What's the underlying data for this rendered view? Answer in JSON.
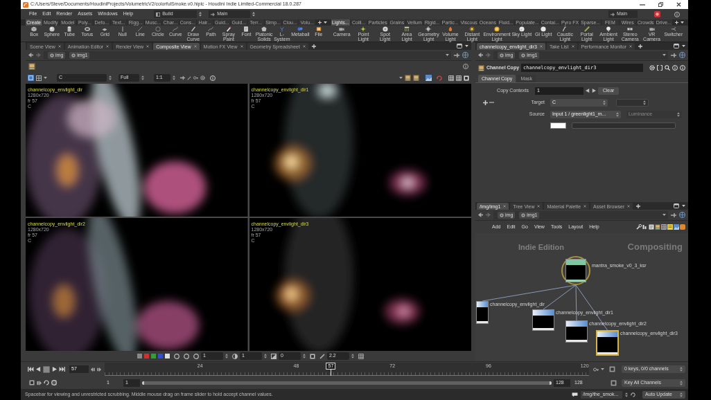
{
  "window": {
    "title": "C:/Users/Steve/Documents/HoudiniProjects/VolumetricV2/colorfulSmoke.v0.hiplc - Houdini Indie Limited-Commercial 18.0.287"
  },
  "menu": [
    "File",
    "Edit",
    "Render",
    "Assets",
    "Windows",
    "Help"
  ],
  "desktop": {
    "desktop": "Build",
    "context": "Main",
    "right_field": "Main"
  },
  "shelves": [
    {
      "tabs": [
        {
          "label": "Create",
          "selected": true
        },
        {
          "label": "Modify",
          "selected": false
        },
        {
          "label": "Model",
          "selected": false
        },
        {
          "label": "Poly...",
          "selected": false
        },
        {
          "label": "Defo...",
          "selected": false
        },
        {
          "label": "Text...",
          "selected": false
        },
        {
          "label": "Rigg...",
          "selected": false
        },
        {
          "label": "Musc...",
          "selected": false
        },
        {
          "label": "Char...",
          "selected": false
        },
        {
          "label": "Cons...",
          "selected": false
        },
        {
          "label": "Hair...",
          "selected": false
        },
        {
          "label": "Guid...",
          "selected": false
        },
        {
          "label": "Guid...",
          "selected": false
        },
        {
          "label": "Terr...",
          "selected": false
        },
        {
          "label": "Simp...",
          "selected": false
        },
        {
          "label": "Clou...",
          "selected": false
        },
        {
          "label": "Volu...",
          "selected": false
        }
      ],
      "tools": [
        "Box",
        "Sphere",
        "Tube",
        "Torus",
        "Grid",
        "Null",
        "Line",
        "Circle",
        "Curve",
        "Draw Curve",
        "Path",
        "Spray Paint",
        "Font",
        "Platonic Solids",
        "L-System",
        "Metaball",
        "File"
      ]
    },
    {
      "tabs": [
        {
          "label": "Lights...",
          "selected": true
        },
        {
          "label": "Colli...",
          "selected": false
        },
        {
          "label": "Particles",
          "selected": false
        },
        {
          "label": "Grains",
          "selected": false
        },
        {
          "label": "Vellum",
          "selected": false
        },
        {
          "label": "Rigid...",
          "selected": false
        },
        {
          "label": "Partic...",
          "selected": false
        },
        {
          "label": "Viscous",
          "selected": false
        },
        {
          "label": "Oceans",
          "selected": false
        },
        {
          "label": "Fluid...",
          "selected": false
        },
        {
          "label": "Populate...",
          "selected": false
        },
        {
          "label": "Contai...",
          "selected": false
        },
        {
          "label": "Pyro FX",
          "selected": false
        },
        {
          "label": "Sparse...",
          "selected": false
        },
        {
          "label": "FEM",
          "selected": false
        },
        {
          "label": "Wires",
          "selected": false
        },
        {
          "label": "Crowds",
          "selected": false
        },
        {
          "label": "Drive...",
          "selected": false
        }
      ],
      "tools": [
        "Camera",
        "Point Light",
        "Spot Light",
        "Area Light",
        "Geometry Light",
        "Volume Light",
        "Distant Light",
        "Environment Light",
        "Sky Light",
        "GI Light",
        "Caustic Light",
        "Portal Light",
        "Ambient Light",
        "Stereo Camera",
        "VR Camera",
        "Switcher"
      ]
    }
  ],
  "viewer": {
    "tabs": [
      {
        "label": "Scene View",
        "selected": false
      },
      {
        "label": "Animation Editor",
        "selected": false
      },
      {
        "label": "Render View",
        "selected": false
      },
      {
        "label": "Composite View",
        "selected": true
      },
      {
        "label": "Motion FX View",
        "selected": false
      },
      {
        "label": "Geometry Spreadsheet",
        "selected": false
      }
    ],
    "path": [
      "img",
      "img1"
    ],
    "toolbar": {
      "plane": "C",
      "resolution": "Full",
      "zoom": "1:1"
    },
    "panes": [
      {
        "name": "channelcopy_envlight_dir",
        "size": "1280x720",
        "frame": "fr 57",
        "plane": "C"
      },
      {
        "name": "channelcopy_envlight_dir1",
        "size": "1280x720",
        "frame": "fr 57",
        "plane": "C"
      },
      {
        "name": "channelcopy_envlight_dir2",
        "size": "1280x720",
        "frame": "fr 57",
        "plane": "C"
      },
      {
        "name": "channelcopy_envlight_dir3",
        "size": "1280x720",
        "frame": "fr 57",
        "plane": "C"
      }
    ],
    "bottom_fields": [
      "1",
      "1",
      "0",
      "2.2"
    ]
  },
  "parameters": {
    "tabs": [
      {
        "label": "channelcopy_envlight_dir3",
        "selected": true
      },
      {
        "label": "Take List",
        "selected": false
      },
      {
        "label": "Performance Monitor",
        "selected": false
      }
    ],
    "path": [
      "img",
      "img1"
    ],
    "node_type": "Channel Copy",
    "node_name": "channelcopy_envlight_dir3",
    "param_tabs": [
      {
        "label": "Channel Copy",
        "selected": true
      },
      {
        "label": "Mask",
        "selected": false
      }
    ],
    "copy_contexts": {
      "label": "Copy Contexts",
      "value": "1",
      "button": "Clear"
    },
    "target": {
      "label": "Target",
      "value": "C"
    },
    "source": {
      "label": "Source",
      "value": "Input 1 / greenlight1_m...",
      "mode": "Luminance",
      "mode_disabled": true
    }
  },
  "network": {
    "tabs": [
      {
        "label": "/img/img1",
        "selected": true
      },
      {
        "label": "Tree View",
        "selected": false
      },
      {
        "label": "Material Palette",
        "selected": false
      },
      {
        "label": "Asset Browser",
        "selected": false
      }
    ],
    "path": [
      "img",
      "img1"
    ],
    "menu": [
      "Add",
      "Edit",
      "Go",
      "View",
      "Tools",
      "Layout",
      "Help"
    ],
    "edition": "Indie Edition",
    "context": "Compositing",
    "nodes": [
      {
        "name": "mantra_smoke_v0_3_ksr",
        "kind": "render",
        "selected": false
      },
      {
        "name": "channelcopy_envlight_dir",
        "kind": "channelcopy",
        "selected": false
      },
      {
        "name": "channelcopy_envlight_dir1",
        "kind": "channelcopy",
        "selected": false
      },
      {
        "name": "channelcopy_envlight_dir2",
        "kind": "channelcopy",
        "selected": false
      },
      {
        "name": "channelcopy_envlight_dir3",
        "kind": "channelcopy",
        "selected": true
      }
    ]
  },
  "timeline": {
    "frame": "57",
    "ticks": [
      "24",
      "48",
      "72",
      "96",
      "120"
    ],
    "playhead": {
      "label": "57",
      "level": 0.467
    },
    "start": "1",
    "range_start": "1",
    "range_slider": {
      "level": 1
    },
    "range_end": "128",
    "end": "128",
    "keys_button": "0 keys, 0/0 channels",
    "key_all_button": "Key All Channels"
  },
  "status_bar": {
    "message": "Spacebar for viewing and unrestricted scrubbing. Middle mouse drag on frame slider to hold accept channel values.",
    "path": "/img/the_smok...",
    "update_button": "Auto Update"
  }
}
